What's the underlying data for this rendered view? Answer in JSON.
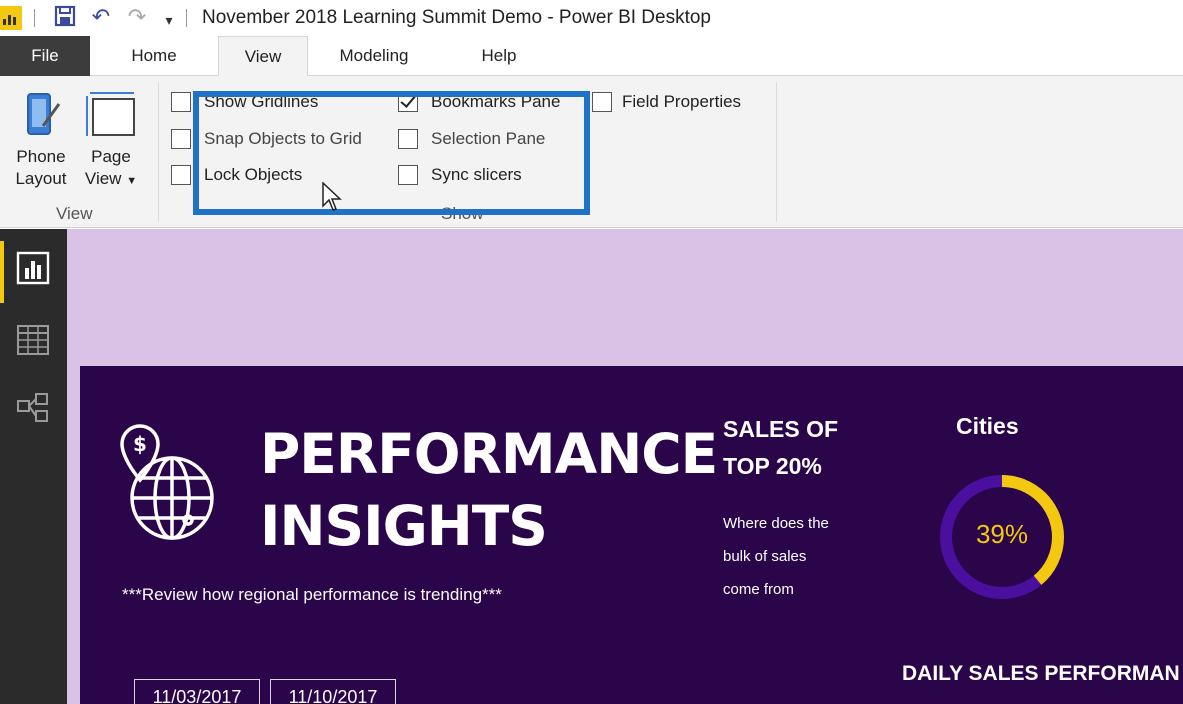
{
  "window": {
    "title": "November 2018 Learning Summit Demo - Power BI Desktop"
  },
  "quick_access": {
    "icons": [
      "power-bi-logo-icon",
      "save-icon",
      "undo-icon",
      "redo-icon",
      "customize-dropdown-icon"
    ]
  },
  "tabs": [
    {
      "label": "File"
    },
    {
      "label": "Home"
    },
    {
      "label": "View"
    },
    {
      "label": "Modeling"
    },
    {
      "label": "Help"
    }
  ],
  "ribbon": {
    "view_group": {
      "label": "View",
      "phone_layout": {
        "line1": "Phone",
        "line2": "Layout"
      },
      "page_view": {
        "line1": "Page",
        "line2": "View"
      }
    },
    "show_group": {
      "label": "Show",
      "checkboxes": {
        "show_gridlines": {
          "label": "Show Gridlines",
          "checked": false
        },
        "snap_objects": {
          "label": "Snap Objects to Grid",
          "checked": false
        },
        "lock_objects": {
          "label": "Lock Objects",
          "checked": false
        },
        "bookmarks_pane": {
          "label": "Bookmarks Pane",
          "checked": true
        },
        "selection_pane": {
          "label": "Selection Pane",
          "checked": false
        },
        "sync_slicers": {
          "label": "Sync slicers",
          "checked": false
        },
        "field_properties": {
          "label": "Field Properties",
          "checked": false
        }
      }
    }
  },
  "left_nav": [
    "report-view-icon",
    "data-view-icon",
    "model-view-icon"
  ],
  "report": {
    "title_line1": "PERFORMANCE",
    "title_line2": "INSIGHTS",
    "subtitle": "***Review how regional performance is trending***",
    "sales_heading_line1": "SALES OF",
    "sales_heading_line2": "TOP 20%",
    "sales_desc_line1": "Where does the",
    "sales_desc_line2": "bulk of sales",
    "sales_desc_line3": "come from",
    "cities_label": "Cities",
    "cities_percent_label": "39%",
    "cities_percent_value": 0.39,
    "daily_heading": "DAILY SALES PERFORMAN",
    "date_start": "11/03/2017",
    "date_end": "11/10/2017"
  },
  "colors": {
    "report_background": "#2a0549",
    "canvas_background": "#d9c2e6",
    "accent_yellow": "#f2c811",
    "donut_track": "#4b0fa0",
    "highlight_box": "#1e73c8",
    "file_tab": "#3c3c3c",
    "left_nav": "#2b2b2b"
  }
}
